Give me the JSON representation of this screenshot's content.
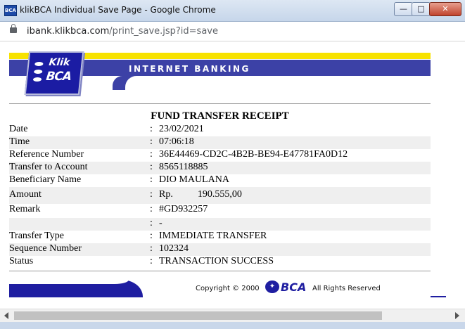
{
  "window": {
    "title": "klikBCA Individual Save Page - Google Chrome",
    "app_icon_text": "BCA",
    "minimize_glyph": "—",
    "maximize_glyph": "□",
    "close_glyph": "✕"
  },
  "address": {
    "host": "ibank.klikbca.com",
    "path": "/print_save.jsp?id=save"
  },
  "header": {
    "logo_line1": "Klik",
    "logo_line2": "BCA",
    "banner": "INTERNET BANKING"
  },
  "receipt": {
    "title": "FUND TRANSFER RECEIPT",
    "rows": [
      {
        "label": "Date",
        "colon": ":",
        "value": "23/02/2021"
      },
      {
        "label": "Time",
        "colon": ":",
        "value": "07:06:18"
      },
      {
        "label": "Reference Number",
        "colon": ":",
        "value": "36E44469-CD2C-4B2B-BE94-E47781FA0D12"
      },
      {
        "label": "Transfer to Account",
        "colon": ":",
        "value": "8565118885"
      },
      {
        "label": "Beneficiary Name",
        "colon": ":",
        "value": "DIO MAULANA"
      },
      {
        "label": "Amount",
        "colon": ":",
        "value": "Rp.          190.555,00"
      },
      {
        "label": "Remark",
        "colon": ":",
        "value": "#GD932257"
      },
      {
        "label": "",
        "colon": ":",
        "value": "-"
      },
      {
        "label": "Transfer Type",
        "colon": ":",
        "value": "IMMEDIATE TRANSFER"
      },
      {
        "label": "Sequence Number",
        "colon": ":",
        "value": "102324"
      },
      {
        "label": "Status",
        "colon": ":",
        "value": "TRANSACTION SUCCESS"
      }
    ]
  },
  "footer": {
    "copyright": "Copyright © 2000",
    "brand": "BCA",
    "rights": "All Rights Reserved"
  }
}
